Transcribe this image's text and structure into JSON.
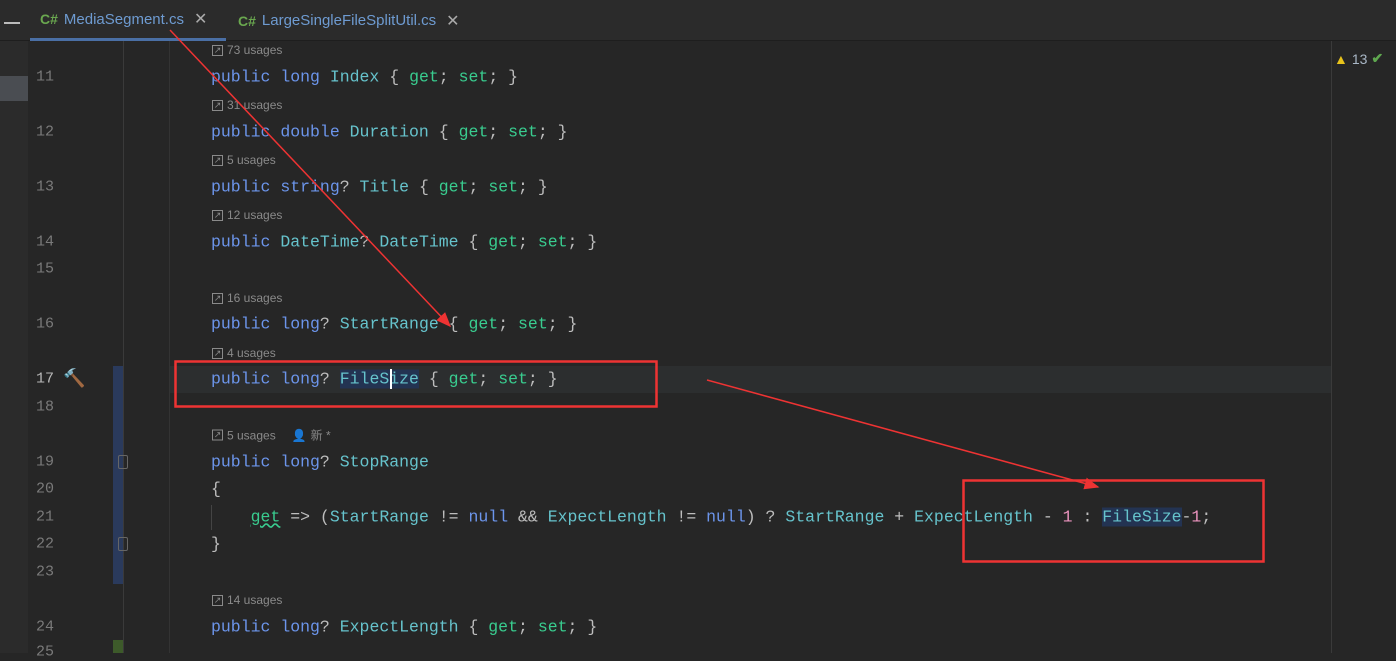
{
  "tabs": [
    {
      "label": "MediaSegment.cs",
      "lang": "C#",
      "active": true
    },
    {
      "label": "LargeSingleFileSplitUtil.cs",
      "lang": "C#",
      "active": false
    }
  ],
  "inspections": {
    "warnings": "13"
  },
  "line_numbers": [
    "11",
    "12",
    "13",
    "14",
    "15",
    "16",
    "17",
    "18",
    "19",
    "20",
    "21",
    "22",
    "23",
    "24",
    "25"
  ],
  "hints": [
    {
      "text": "73 usages"
    },
    {
      "text": "31 usages"
    },
    {
      "text": "5 usages"
    },
    {
      "text": "12 usages"
    },
    {
      "text": "16 usages"
    },
    {
      "text": "4 usages"
    },
    {
      "text": "5 usages",
      "author": "新 *"
    },
    {
      "text": "14 usages"
    }
  ],
  "code": [
    [
      [
        "public ",
        "kw"
      ],
      [
        "long ",
        "kw"
      ],
      [
        "Index",
        "ty"
      ],
      [
        " { ",
        "pn"
      ],
      [
        "get",
        "acc"
      ],
      [
        "; ",
        "pn"
      ],
      [
        "set",
        "acc"
      ],
      [
        "; }",
        "pn"
      ]
    ],
    [
      [
        "public ",
        "kw"
      ],
      [
        "double ",
        "kw"
      ],
      [
        "Duration",
        "ty"
      ],
      [
        " { ",
        "pn"
      ],
      [
        "get",
        "acc"
      ],
      [
        "; ",
        "pn"
      ],
      [
        "set",
        "acc"
      ],
      [
        "; }",
        "pn"
      ]
    ],
    [
      [
        "public ",
        "kw"
      ],
      [
        "string",
        "kw"
      ],
      [
        "? ",
        "pn"
      ],
      [
        "Title",
        "ty"
      ],
      [
        " { ",
        "pn"
      ],
      [
        "get",
        "acc"
      ],
      [
        "; ",
        "pn"
      ],
      [
        "set",
        "acc"
      ],
      [
        "; }",
        "pn"
      ]
    ],
    [
      [
        "public ",
        "kw"
      ],
      [
        "DateTime",
        "ty"
      ],
      [
        "? ",
        "pn"
      ],
      [
        "DateTime",
        "ty"
      ],
      [
        " { ",
        "pn"
      ],
      [
        "get",
        "acc"
      ],
      [
        "; ",
        "pn"
      ],
      [
        "set",
        "acc"
      ],
      [
        "; }",
        "pn"
      ]
    ],
    [],
    [
      [
        "public ",
        "kw"
      ],
      [
        "long",
        "kw"
      ],
      [
        "? ",
        "pn"
      ],
      [
        "StartRange",
        "ty"
      ],
      [
        " { ",
        "pn"
      ],
      [
        "get",
        "acc"
      ],
      [
        "; ",
        "pn"
      ],
      [
        "set",
        "acc"
      ],
      [
        "; }",
        "pn"
      ]
    ],
    [
      [
        "public ",
        "kw"
      ],
      [
        "long",
        "kw"
      ],
      [
        "? ",
        "pn"
      ],
      [
        "FileSize",
        "ty hl"
      ],
      [
        " { ",
        "pn"
      ],
      [
        "get",
        "acc"
      ],
      [
        "; ",
        "pn"
      ],
      [
        "set",
        "acc"
      ],
      [
        "; }",
        "pn"
      ]
    ],
    [],
    [
      [
        "public ",
        "kw"
      ],
      [
        "long",
        "kw"
      ],
      [
        "? ",
        "pn"
      ],
      [
        "StopRange",
        "ty"
      ]
    ],
    [
      [
        "{",
        "pn"
      ]
    ],
    [
      [
        "    ",
        "pn"
      ],
      [
        "get",
        "acc"
      ],
      [
        " => (",
        "pn"
      ],
      [
        "StartRange",
        "ty"
      ],
      [
        " != ",
        "pn"
      ],
      [
        "null",
        "kw"
      ],
      [
        " && ",
        "pn"
      ],
      [
        "ExpectLength",
        "ty"
      ],
      [
        " != ",
        "pn"
      ],
      [
        "null",
        "kw"
      ],
      [
        ") ? ",
        "pn"
      ],
      [
        "StartRange",
        "ty"
      ],
      [
        " + ",
        "pn"
      ],
      [
        "ExpectLength",
        "ty"
      ],
      [
        " - ",
        "pn"
      ],
      [
        "1",
        "nb"
      ],
      [
        " : ",
        "pn"
      ],
      [
        "FileSize",
        "ty hl"
      ],
      [
        "-",
        "pn"
      ],
      [
        "1",
        "nb"
      ],
      [
        ";",
        "pn"
      ]
    ],
    [
      [
        "}",
        "pn"
      ]
    ],
    [],
    [
      [
        "public ",
        "kw"
      ],
      [
        "long",
        "kw"
      ],
      [
        "? ",
        "pn"
      ],
      [
        "ExpectLength",
        "ty"
      ],
      [
        " { ",
        "pn"
      ],
      [
        "get",
        "acc"
      ],
      [
        "; ",
        "pn"
      ],
      [
        "set",
        "acc"
      ],
      [
        "; }",
        "pn"
      ]
    ],
    []
  ],
  "colors": {
    "keyword": "#6c95eb",
    "identifier": "#66c3cc",
    "accessor": "#39cc8f",
    "number": "#ed94c0",
    "annotation": "#ee3333"
  }
}
